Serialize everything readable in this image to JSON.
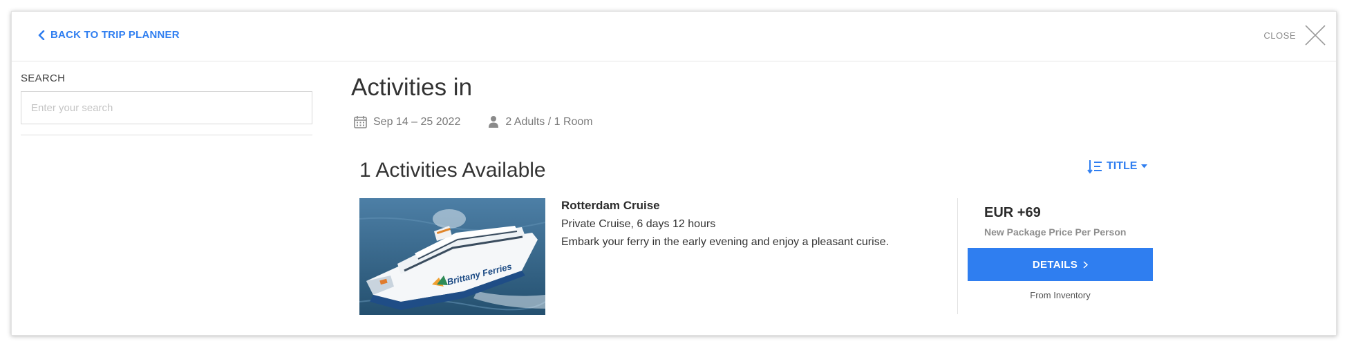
{
  "header": {
    "back_label": "BACK TO TRIP PLANNER",
    "close_label": "CLOSE"
  },
  "sidebar": {
    "search_label": "SEARCH",
    "search_placeholder": "Enter your search",
    "search_value": ""
  },
  "main": {
    "title": "Activities in",
    "dates": "Sep 14 – 25 2022",
    "guests": "2 Adults / 1 Room",
    "results_count": "1 Activities Available",
    "sort_label": "TITLE"
  },
  "activities": [
    {
      "name": "Rotterdam Cruise",
      "subtitle": "Private Cruise, 6 days 12 hours",
      "description": "Embark your ferry in the early evening and enjoy a pleasant curise.",
      "image_text": "Brittany Ferries",
      "price": "EUR +69",
      "price_note": "New Package Price Per Person",
      "details_label": "DETAILS",
      "source_note": "From Inventory"
    }
  ],
  "colors": {
    "accent": "#2f7ef0",
    "text_primary": "#333333",
    "text_muted": "#7a7a7a",
    "sea": "#2f5f86"
  }
}
